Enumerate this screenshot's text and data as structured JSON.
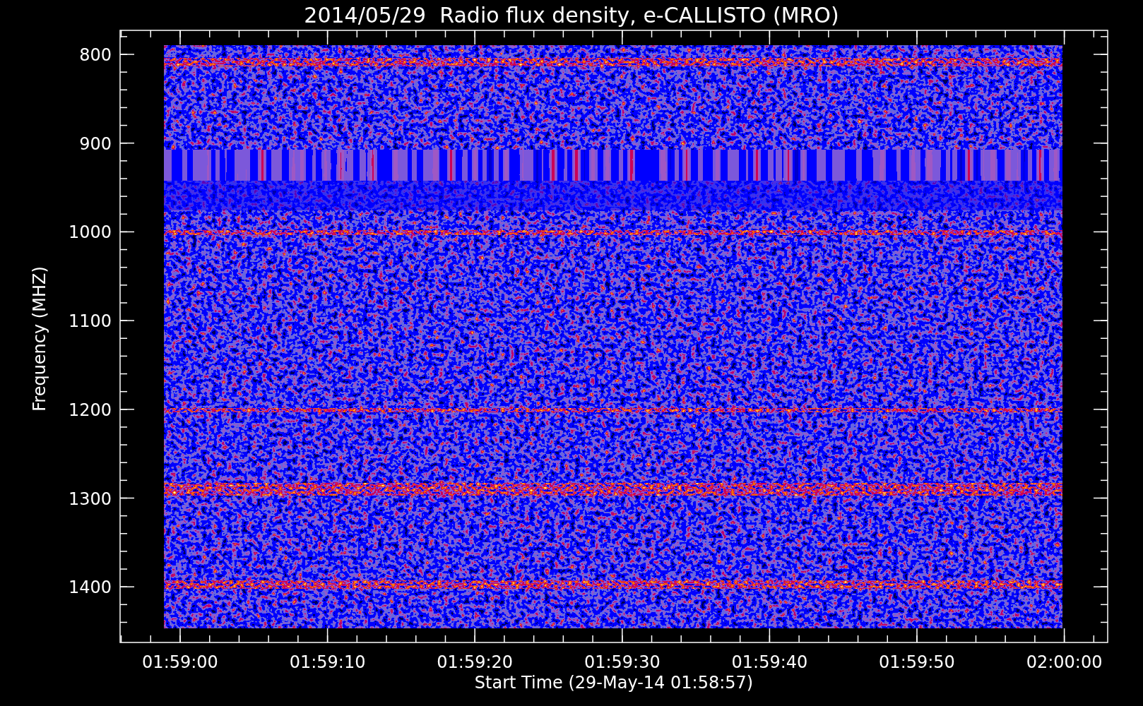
{
  "title": "2014/05/29  Radio flux density, e-CALLISTO (MRO)",
  "y_axis": {
    "label": "Frequency (MHZ)",
    "ticks": [
      "800",
      "900",
      "1000",
      "1100",
      "1200",
      "1300",
      "1400"
    ]
  },
  "x_axis": {
    "label": "Start Time (29-May-14 01:58:57)",
    "ticks": [
      "01:59:00",
      "01:59:10",
      "01:59:20",
      "01:59:30",
      "01:59:40",
      "01:59:50",
      "02:00:00"
    ]
  }
}
